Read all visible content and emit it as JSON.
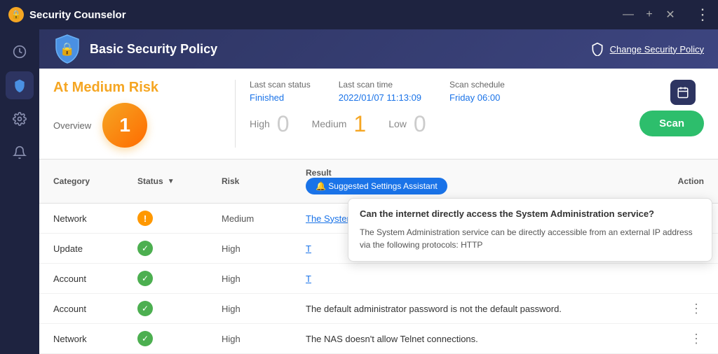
{
  "app": {
    "title": "Security Counselor",
    "window_controls": {
      "minimize": "—",
      "maximize": "+",
      "close": "✕",
      "more": "⋮"
    }
  },
  "sidebar": {
    "items": [
      {
        "id": "dashboard",
        "icon": "⏱",
        "active": false
      },
      {
        "id": "security",
        "icon": "🛡",
        "active": true
      },
      {
        "id": "settings",
        "icon": "⚙",
        "active": false
      },
      {
        "id": "notifications",
        "icon": "📢",
        "active": false
      }
    ]
  },
  "policy_header": {
    "title": "Basic Security Policy",
    "change_label": "Change Security Policy"
  },
  "risk": {
    "title": "At Medium Risk",
    "count": "1",
    "overview_label": "Overview"
  },
  "scan_info": {
    "last_status_label": "Last scan status",
    "last_status_value": "Finished",
    "last_time_label": "Last scan time",
    "last_time_value": "2022/01/07 11:13:09",
    "schedule_label": "Scan schedule",
    "schedule_value": "Friday 06:00"
  },
  "severity": {
    "high_label": "High",
    "high_count": "0",
    "medium_label": "Medium",
    "medium_count": "1",
    "low_label": "Low",
    "low_count": "0"
  },
  "scan_button": "Scan",
  "table": {
    "headers": {
      "category": "Category",
      "status": "Status",
      "status_sort": "▼",
      "risk": "Risk",
      "result": "Result",
      "action": "Action"
    },
    "suggested_label": "🔔 Suggested Settings Assistant",
    "rows": [
      {
        "category": "Network",
        "status": "warning",
        "risk": "Medium",
        "result": "The System Administration service can be directly accessible from an external IP address...",
        "result_type": "link",
        "action": "⋮"
      },
      {
        "category": "Update",
        "status": "ok",
        "risk": "High",
        "result": "T",
        "result_type": "link",
        "action": ""
      },
      {
        "category": "Account",
        "status": "ok",
        "risk": "High",
        "result": "T",
        "result_type": "link",
        "action": ""
      },
      {
        "category": "Account",
        "status": "ok",
        "risk": "High",
        "result": "The default administrator password is not the default password.",
        "result_type": "normal",
        "action": "⋮"
      },
      {
        "category": "Network",
        "status": "ok",
        "risk": "High",
        "result": "The NAS doesn't allow Telnet connections.",
        "result_type": "normal",
        "action": "⋮"
      }
    ]
  },
  "tooltip": {
    "question": "Can the internet directly access the System Administration service?",
    "answer": "The System Administration service can be directly accessible from an external IP address via the following protocols: HTTP"
  },
  "colors": {
    "accent_orange": "#f5a623",
    "accent_blue": "#1a73e8",
    "accent_green": "#2dbe6c",
    "sidebar_bg": "#1e2340",
    "header_bg": "#2d3461",
    "warning": "#ff9800",
    "success": "#4caf50"
  }
}
